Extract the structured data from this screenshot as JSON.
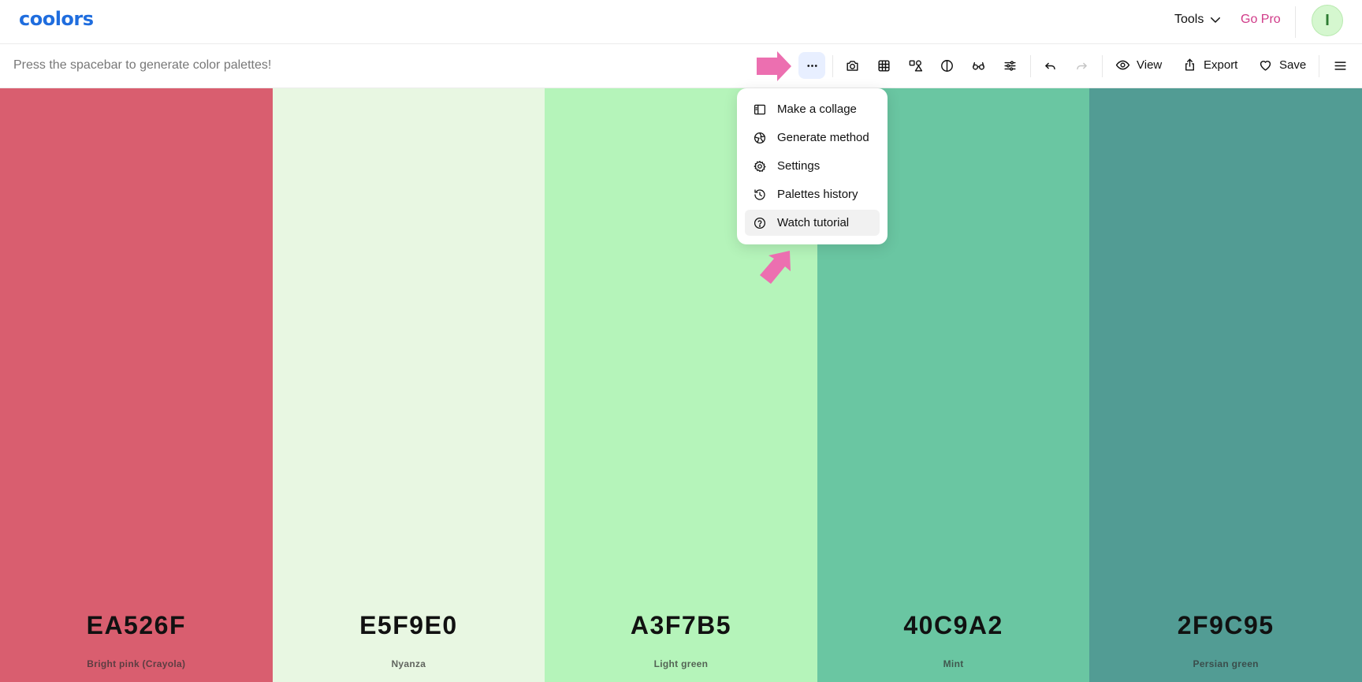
{
  "header": {
    "logo": "coolors",
    "tools_label": "Tools",
    "gopro_label": "Go Pro",
    "avatar_initial": "I"
  },
  "toolbar": {
    "hint": "Press the spacebar to generate color palettes!",
    "icons": [
      "more-icon",
      "camera-icon",
      "grid-icon",
      "shapes-icon",
      "contrast-icon",
      "glasses-icon",
      "sliders-icon",
      "undo-icon",
      "redo-icon"
    ],
    "view_label": "View",
    "export_label": "Export",
    "save_label": "Save"
  },
  "menu": {
    "items": [
      {
        "label": "Make a collage",
        "icon": "collage-icon"
      },
      {
        "label": "Generate method",
        "icon": "aperture-icon"
      },
      {
        "label": "Settings",
        "icon": "gear-icon"
      },
      {
        "label": "Palettes history",
        "icon": "history-icon"
      },
      {
        "label": "Watch tutorial",
        "icon": "help-circle-icon"
      }
    ]
  },
  "palette": [
    {
      "hex": "EA526F",
      "name": "Bright pink (Crayola)",
      "color": "#d95e6f"
    },
    {
      "hex": "E5F9E0",
      "name": "Nyanza",
      "color": "#e8f7e2"
    },
    {
      "hex": "A3F7B5",
      "name": "Light green",
      "color": "#b5f4ba"
    },
    {
      "hex": "40C9A2",
      "name": "Mint",
      "color": "#6ac6a2"
    },
    {
      "hex": "2F9C95",
      "name": "Persian green",
      "color": "#529c94"
    }
  ],
  "colors": {
    "logo": "#1f6dde",
    "gopro": "#d03a88",
    "annotation_arrow": "#ec6fb0"
  }
}
